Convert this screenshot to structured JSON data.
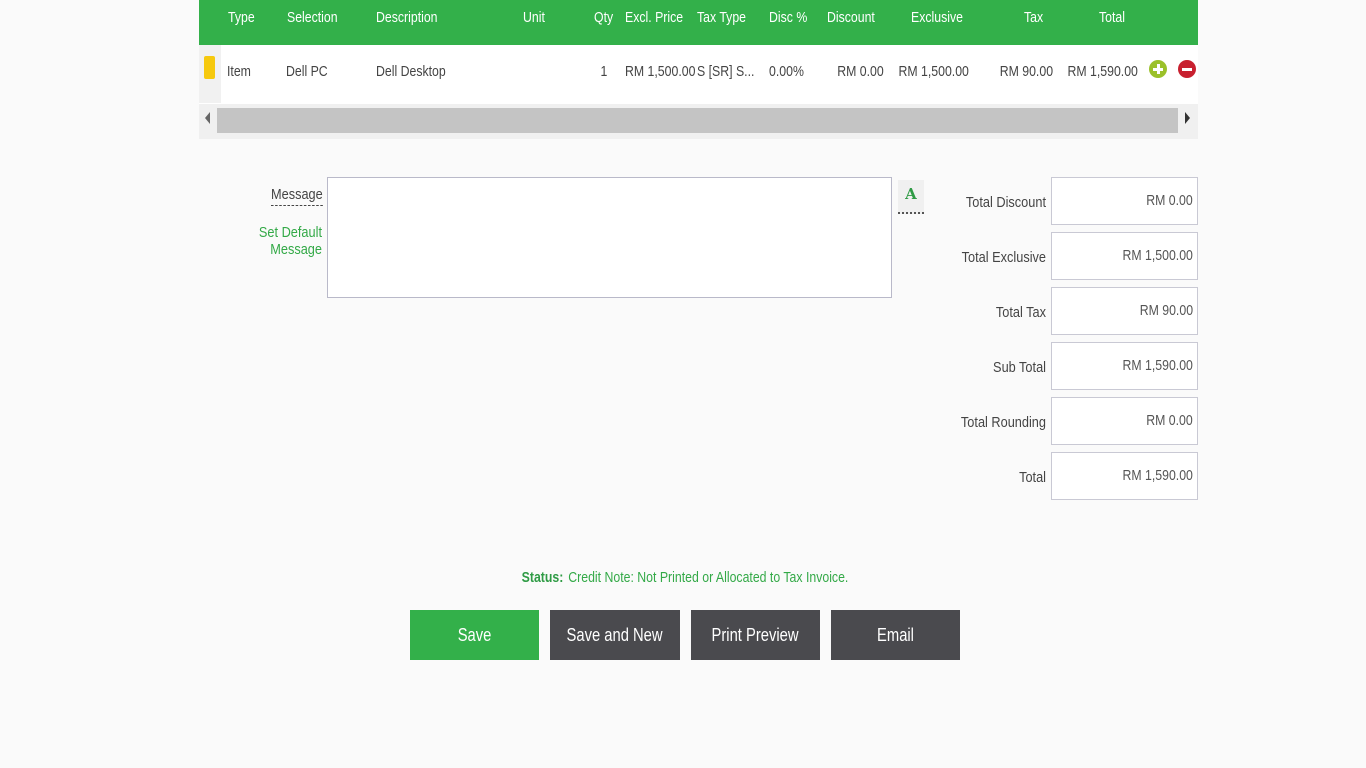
{
  "grid": {
    "headers": {
      "type": "Type",
      "selection": "Selection",
      "description": "Description",
      "unit": "Unit",
      "qty": "Qty",
      "excl_price": "Excl. Price",
      "tax_type": "Tax Type",
      "disc_pct": "Disc %",
      "discount": "Discount",
      "exclusive": "Exclusive",
      "tax": "Tax",
      "total": "Total"
    },
    "row": {
      "type": "Item",
      "selection": "Dell PC",
      "description": "Dell Desktop",
      "unit": "",
      "qty": "1",
      "excl_price": "RM 1,500.00",
      "tax_type": "S [SR] S...",
      "disc_pct": "0.00%",
      "discount": "RM 0.00",
      "exclusive": "RM 1,500.00",
      "tax": "RM 90.00",
      "total": "RM 1,590.00"
    }
  },
  "message": {
    "label": "Message",
    "set_default": "Set Default Message",
    "value": "",
    "font_icon_glyph": "A"
  },
  "totals": {
    "total_discount": {
      "label": "Total Discount",
      "value": "RM 0.00"
    },
    "total_exclusive": {
      "label": "Total Exclusive",
      "value": "RM 1,500.00"
    },
    "total_tax": {
      "label": "Total Tax",
      "value": "RM 90.00"
    },
    "sub_total": {
      "label": "Sub Total",
      "value": "RM 1,590.00"
    },
    "total_rounding": {
      "label": "Total Rounding",
      "value": "RM 0.00"
    },
    "total": {
      "label": "Total",
      "value": "RM 1,590.00"
    }
  },
  "status": {
    "label": "Status:",
    "text": "Credit Note: Not Printed or Allocated to Tax Invoice."
  },
  "buttons": {
    "save": "Save",
    "save_and_new": "Save and New",
    "print_preview": "Print Preview",
    "email": "Email"
  },
  "colors": {
    "accent_green": "#33b04a",
    "dark_button": "#4a4a4e",
    "add_icon": "#9bc12a",
    "remove_icon": "#c8202f",
    "row_marker": "#f6c90e"
  },
  "icons": {
    "row_marker": "document-icon",
    "add": "add-circle-icon",
    "remove": "remove-circle-icon",
    "font": "font-format-icon"
  }
}
